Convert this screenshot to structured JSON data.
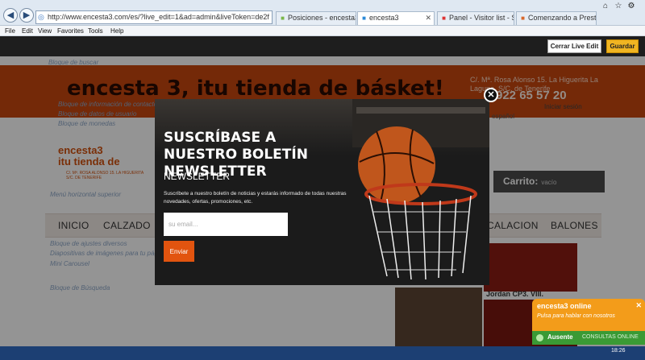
{
  "browser": {
    "address": "http://www.encesta3.com/es/?live_edit=1&ad=admin&liveToken=de2f",
    "tabs": [
      {
        "label": "Posiciones - encesta3"
      },
      {
        "label": "encesta3"
      },
      {
        "label": "Panel - Visitor list - State"
      },
      {
        "label": "Comenzando a Prestashop"
      }
    ],
    "menu": [
      "File",
      "Edit",
      "View",
      "Favorites",
      "Tools",
      "Help"
    ]
  },
  "livebar": {
    "close_label": "Cerrar Live Edit",
    "save_label": "Guardar"
  },
  "page": {
    "block_search": "Bloque de buscar",
    "header_title": "encesta 3, itu tienda de básket!",
    "header_address": "C/. Mª. Rosa Alonso 15. La Higuerita La Laguna, S/C. de Tenerife",
    "header_phone": "922 65 57 20",
    "login": "Iniciar sesión",
    "block_contact_info": "Bloque de información de contacto",
    "block_user_info": "Bloque de datos de usuario",
    "block_currency": "Bloque de monedas",
    "language": "español",
    "logo2": "encesta3",
    "logo2_line2": "itu tienda de",
    "logo2_sub": "C/. Mª. ROSA ALONSO 15. LA HIGUERITA S/C. DE TENERIFE",
    "cart_label": "Carrito:",
    "cart_value": "vacío",
    "menu_label": "Menú horizontal superior",
    "menu_tabs": [
      "INICIO",
      "CALZADO",
      "CALACION",
      "BALONES"
    ],
    "block_social": "Bloque de ajustes diversos",
    "block_banner": "Diapositivas de imágenes para tu página de inicio",
    "block_carousel": "Mini Carousel",
    "block_search2": "Bloque de Búsqueda",
    "product_label": "Jordan CP3. VIII."
  },
  "modal": {
    "title": "SUSCRÍBASE A NUESTRO BOLETÍN NEWSLETTER",
    "subtitle": "NEWSLETTER",
    "description": "Suscríbete a nuestro boletín de noticias y estarás informado de todas nuestras novedades, ofertas, promociones, etc.",
    "email_placeholder": "su email...",
    "send_label": "Enviar"
  },
  "chat": {
    "title": "encesta3 online",
    "subtitle": "Pulsa para hablar con nosotros",
    "status": "Ausente",
    "consult": "CONSULTAS ONLINE"
  },
  "taskbar": {
    "time": "18:26"
  }
}
